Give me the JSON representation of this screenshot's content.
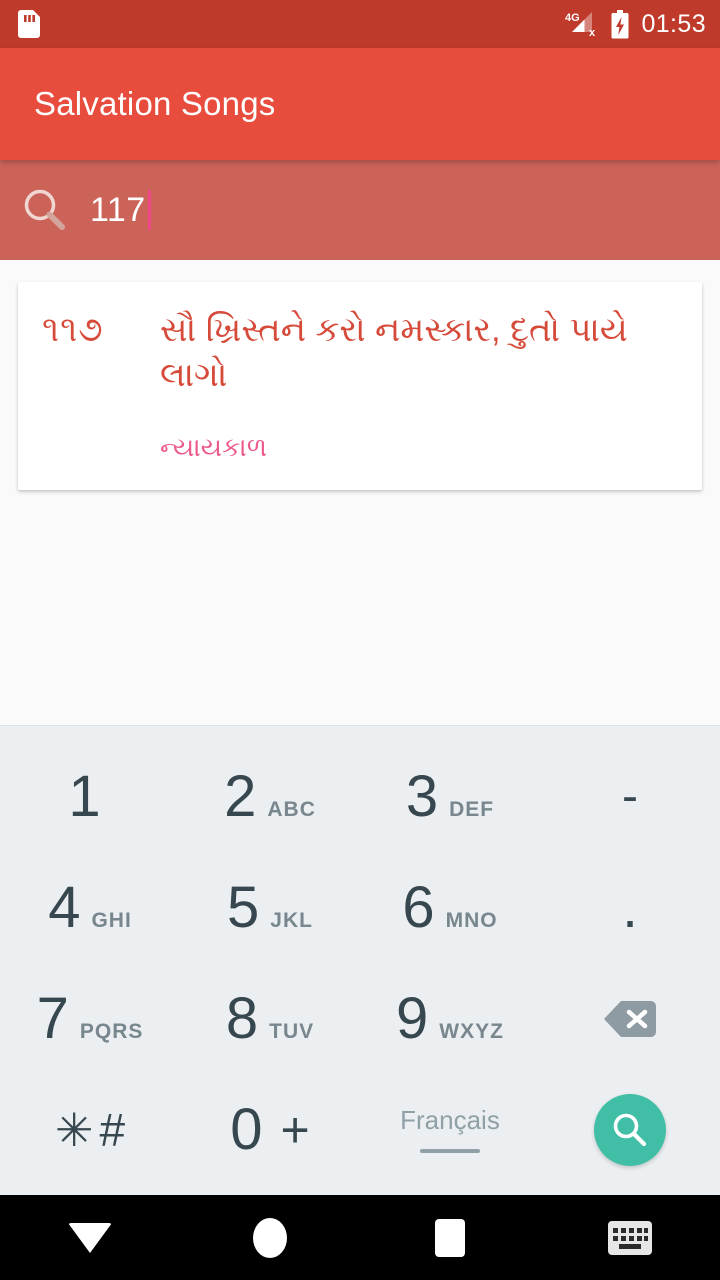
{
  "status_bar": {
    "sim_icon": "sim-card-icon",
    "network_label": "4G",
    "signal_icon": "signal-no-service-icon",
    "battery_icon": "battery-charging-icon",
    "clock": "01:53",
    "background_color": "#BF3A2A",
    "foreground_color": "#FFFFFF"
  },
  "app_bar": {
    "title": "Salvation Songs",
    "background_color": "#E74C3C",
    "title_color": "#FFFFFF"
  },
  "search": {
    "icon": "search-icon",
    "value": "117",
    "placeholder": "Search",
    "background_color": "#CC6359",
    "text_color": "#FFFFFF",
    "caret_color": "#F0468A"
  },
  "results": {
    "items": [
      {
        "number": "૧૧૭",
        "title": "સૌ ખ્રિસ્તને કરો નમસ્કાર, દુતો પાયે લાગો",
        "subtitle": "ન્યાયકાળ",
        "number_color": "#D64A3A",
        "title_color": "#D64A3A",
        "subtitle_color": "#EC5A8C"
      }
    ]
  },
  "keypad": {
    "background_color": "#ECEFF1",
    "digit_color": "#37474F",
    "letters_color": "#78868D",
    "rows": [
      [
        {
          "name": "key-1",
          "digit": "1",
          "letters": ""
        },
        {
          "name": "key-2",
          "digit": "2",
          "letters": "ABC"
        },
        {
          "name": "key-3",
          "digit": "3",
          "letters": "DEF"
        },
        {
          "name": "key-hyphen",
          "symbol": "-"
        }
      ],
      [
        {
          "name": "key-4",
          "digit": "4",
          "letters": "GHI"
        },
        {
          "name": "key-5",
          "digit": "5",
          "letters": "JKL"
        },
        {
          "name": "key-6",
          "digit": "6",
          "letters": "MNO"
        },
        {
          "name": "key-period",
          "symbol": "."
        }
      ],
      [
        {
          "name": "key-7",
          "digit": "7",
          "letters": "PQRS"
        },
        {
          "name": "key-8",
          "digit": "8",
          "letters": "TUV"
        },
        {
          "name": "key-9",
          "digit": "9",
          "letters": "WXYZ"
        },
        {
          "name": "key-backspace",
          "icon": "backspace-icon"
        }
      ],
      [
        {
          "name": "key-star-hash",
          "star": "✳",
          "hash": "#"
        },
        {
          "name": "key-zero-plus",
          "digit": "0",
          "plus": "+"
        },
        {
          "name": "key-language",
          "label": "Français"
        },
        {
          "name": "key-search",
          "icon": "search-icon",
          "color": "#41BFA6"
        }
      ]
    ]
  },
  "nav_bar": {
    "background_color": "#000000",
    "buttons": [
      {
        "name": "nav-back-dismiss-keyboard",
        "icon": "caret-down-icon"
      },
      {
        "name": "nav-home",
        "icon": "circle-home-icon"
      },
      {
        "name": "nav-recents",
        "icon": "square-recents-icon"
      },
      {
        "name": "nav-keyboard-switch",
        "icon": "keyboard-icon"
      }
    ]
  }
}
